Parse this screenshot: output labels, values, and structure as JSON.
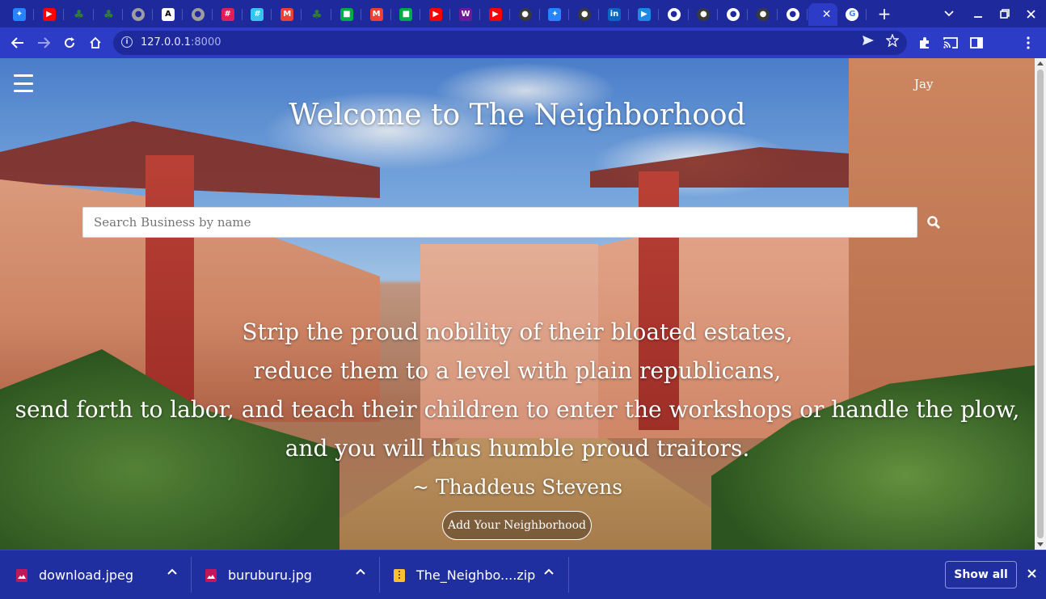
{
  "browser": {
    "tabs": [
      {
        "icon": "jira-icon",
        "color": "#2684ff",
        "glyph": "✦"
      },
      {
        "icon": "youtube-icon",
        "color": "#ff0000",
        "glyph": "▶"
      },
      {
        "icon": "tree-icon",
        "color": "#2e7d32",
        "glyph": "♣"
      },
      {
        "icon": "tree-icon",
        "color": "#2e7d32",
        "glyph": "♣"
      },
      {
        "icon": "globe-icon",
        "color": "#9e9e9e",
        "glyph": "●"
      },
      {
        "icon": "font-a-icon",
        "color": "#ffffff",
        "glyph": "A"
      },
      {
        "icon": "globe-icon",
        "color": "#9e9e9e",
        "glyph": "●"
      },
      {
        "icon": "slack-icon",
        "color": "#e01e5a",
        "glyph": "#"
      },
      {
        "icon": "slack-icon",
        "color": "#36c5f0",
        "glyph": "#"
      },
      {
        "icon": "gmail-icon",
        "color": "#ea4335",
        "glyph": "M"
      },
      {
        "icon": "tree-icon",
        "color": "#2e7d32",
        "glyph": "♣"
      },
      {
        "icon": "google-meet-icon",
        "color": "#00ac47",
        "glyph": "■"
      },
      {
        "icon": "gmail-icon",
        "color": "#ea4335",
        "glyph": "M"
      },
      {
        "icon": "google-meet-icon",
        "color": "#00ac47",
        "glyph": "■"
      },
      {
        "icon": "youtube-icon",
        "color": "#ff0000",
        "glyph": "▶"
      },
      {
        "icon": "waveform-icon",
        "color": "#6a1b9a",
        "glyph": "W"
      },
      {
        "icon": "youtube-icon",
        "color": "#ff0000",
        "glyph": "▶"
      },
      {
        "icon": "github-icon",
        "color": "#3a3a3a",
        "glyph": "●"
      },
      {
        "icon": "jira-icon",
        "color": "#2684ff",
        "glyph": "✦"
      },
      {
        "icon": "github-icon",
        "color": "#3a3a3a",
        "glyph": "●"
      },
      {
        "icon": "linkedin-icon",
        "color": "#0a66c2",
        "glyph": "in"
      },
      {
        "icon": "video-player-icon",
        "color": "#1e88e5",
        "glyph": "▶"
      },
      {
        "icon": "globe-icon",
        "color": "#ffffff",
        "glyph": "●"
      },
      {
        "icon": "github-icon",
        "color": "#3a3a3a",
        "glyph": "●"
      },
      {
        "icon": "globe-icon",
        "color": "#ffffff",
        "glyph": "●"
      },
      {
        "icon": "github-icon",
        "color": "#3a3a3a",
        "glyph": "●"
      },
      {
        "icon": "globe-icon",
        "color": "#ffffff",
        "glyph": "●"
      },
      {
        "icon": "active-tab",
        "color": "#2c3cc7",
        "glyph": "'"
      },
      {
        "icon": "google-icon",
        "color": "#4285f4",
        "glyph": "G"
      }
    ],
    "new_tab_glyph": "+",
    "url_host": "127.0.0.1",
    "url_port": ":8000"
  },
  "page": {
    "user_name": "Jay",
    "welcome_title": "Welcome to The Neighborhood",
    "search_placeholder": "Search Business by name",
    "quote_lines": [
      "Strip the proud nobility of their bloated estates,",
      "reduce them to a level with plain republicans,",
      "send forth to labor, and teach their children to enter the workshops or handle the plow,",
      "and you will thus humble proud traitors."
    ],
    "quote_author": "~ Thaddeus Stevens",
    "add_button_label": "Add Your Neighborhood"
  },
  "downloads": {
    "items": [
      {
        "name": "download.jpeg",
        "icon": "image-file-icon",
        "color": "#c2185b"
      },
      {
        "name": "buruburu.jpg",
        "icon": "image-file-icon",
        "color": "#c2185b"
      },
      {
        "name": "The_Neighbo....zip",
        "icon": "zip-file-icon",
        "color": "#fbc02d"
      }
    ],
    "show_all_label": "Show all"
  }
}
